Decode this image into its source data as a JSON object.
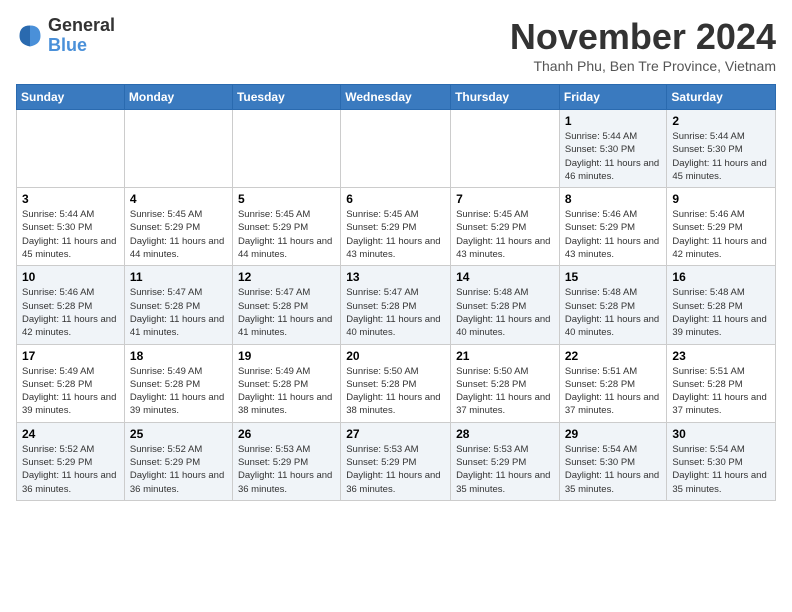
{
  "logo": {
    "line1": "General",
    "line2": "Blue"
  },
  "title": "November 2024",
  "location": "Thanh Phu, Ben Tre Province, Vietnam",
  "weekdays": [
    "Sunday",
    "Monday",
    "Tuesday",
    "Wednesday",
    "Thursday",
    "Friday",
    "Saturday"
  ],
  "weeks": [
    [
      {
        "day": "",
        "content": ""
      },
      {
        "day": "",
        "content": ""
      },
      {
        "day": "",
        "content": ""
      },
      {
        "day": "",
        "content": ""
      },
      {
        "day": "",
        "content": ""
      },
      {
        "day": "1",
        "content": "Sunrise: 5:44 AM\nSunset: 5:30 PM\nDaylight: 11 hours\nand 46 minutes."
      },
      {
        "day": "2",
        "content": "Sunrise: 5:44 AM\nSunset: 5:30 PM\nDaylight: 11 hours\nand 45 minutes."
      }
    ],
    [
      {
        "day": "3",
        "content": "Sunrise: 5:44 AM\nSunset: 5:30 PM\nDaylight: 11 hours\nand 45 minutes."
      },
      {
        "day": "4",
        "content": "Sunrise: 5:45 AM\nSunset: 5:29 PM\nDaylight: 11 hours\nand 44 minutes."
      },
      {
        "day": "5",
        "content": "Sunrise: 5:45 AM\nSunset: 5:29 PM\nDaylight: 11 hours\nand 44 minutes."
      },
      {
        "day": "6",
        "content": "Sunrise: 5:45 AM\nSunset: 5:29 PM\nDaylight: 11 hours\nand 43 minutes."
      },
      {
        "day": "7",
        "content": "Sunrise: 5:45 AM\nSunset: 5:29 PM\nDaylight: 11 hours\nand 43 minutes."
      },
      {
        "day": "8",
        "content": "Sunrise: 5:46 AM\nSunset: 5:29 PM\nDaylight: 11 hours\nand 43 minutes."
      },
      {
        "day": "9",
        "content": "Sunrise: 5:46 AM\nSunset: 5:29 PM\nDaylight: 11 hours\nand 42 minutes."
      }
    ],
    [
      {
        "day": "10",
        "content": "Sunrise: 5:46 AM\nSunset: 5:28 PM\nDaylight: 11 hours\nand 42 minutes."
      },
      {
        "day": "11",
        "content": "Sunrise: 5:47 AM\nSunset: 5:28 PM\nDaylight: 11 hours\nand 41 minutes."
      },
      {
        "day": "12",
        "content": "Sunrise: 5:47 AM\nSunset: 5:28 PM\nDaylight: 11 hours\nand 41 minutes."
      },
      {
        "day": "13",
        "content": "Sunrise: 5:47 AM\nSunset: 5:28 PM\nDaylight: 11 hours\nand 40 minutes."
      },
      {
        "day": "14",
        "content": "Sunrise: 5:48 AM\nSunset: 5:28 PM\nDaylight: 11 hours\nand 40 minutes."
      },
      {
        "day": "15",
        "content": "Sunrise: 5:48 AM\nSunset: 5:28 PM\nDaylight: 11 hours\nand 40 minutes."
      },
      {
        "day": "16",
        "content": "Sunrise: 5:48 AM\nSunset: 5:28 PM\nDaylight: 11 hours\nand 39 minutes."
      }
    ],
    [
      {
        "day": "17",
        "content": "Sunrise: 5:49 AM\nSunset: 5:28 PM\nDaylight: 11 hours\nand 39 minutes."
      },
      {
        "day": "18",
        "content": "Sunrise: 5:49 AM\nSunset: 5:28 PM\nDaylight: 11 hours\nand 39 minutes."
      },
      {
        "day": "19",
        "content": "Sunrise: 5:49 AM\nSunset: 5:28 PM\nDaylight: 11 hours\nand 38 minutes."
      },
      {
        "day": "20",
        "content": "Sunrise: 5:50 AM\nSunset: 5:28 PM\nDaylight: 11 hours\nand 38 minutes."
      },
      {
        "day": "21",
        "content": "Sunrise: 5:50 AM\nSunset: 5:28 PM\nDaylight: 11 hours\nand 37 minutes."
      },
      {
        "day": "22",
        "content": "Sunrise: 5:51 AM\nSunset: 5:28 PM\nDaylight: 11 hours\nand 37 minutes."
      },
      {
        "day": "23",
        "content": "Sunrise: 5:51 AM\nSunset: 5:28 PM\nDaylight: 11 hours\nand 37 minutes."
      }
    ],
    [
      {
        "day": "24",
        "content": "Sunrise: 5:52 AM\nSunset: 5:29 PM\nDaylight: 11 hours\nand 36 minutes."
      },
      {
        "day": "25",
        "content": "Sunrise: 5:52 AM\nSunset: 5:29 PM\nDaylight: 11 hours\nand 36 minutes."
      },
      {
        "day": "26",
        "content": "Sunrise: 5:53 AM\nSunset: 5:29 PM\nDaylight: 11 hours\nand 36 minutes."
      },
      {
        "day": "27",
        "content": "Sunrise: 5:53 AM\nSunset: 5:29 PM\nDaylight: 11 hours\nand 36 minutes."
      },
      {
        "day": "28",
        "content": "Sunrise: 5:53 AM\nSunset: 5:29 PM\nDaylight: 11 hours\nand 35 minutes."
      },
      {
        "day": "29",
        "content": "Sunrise: 5:54 AM\nSunset: 5:30 PM\nDaylight: 11 hours\nand 35 minutes."
      },
      {
        "day": "30",
        "content": "Sunrise: 5:54 AM\nSunset: 5:30 PM\nDaylight: 11 hours\nand 35 minutes."
      }
    ]
  ]
}
